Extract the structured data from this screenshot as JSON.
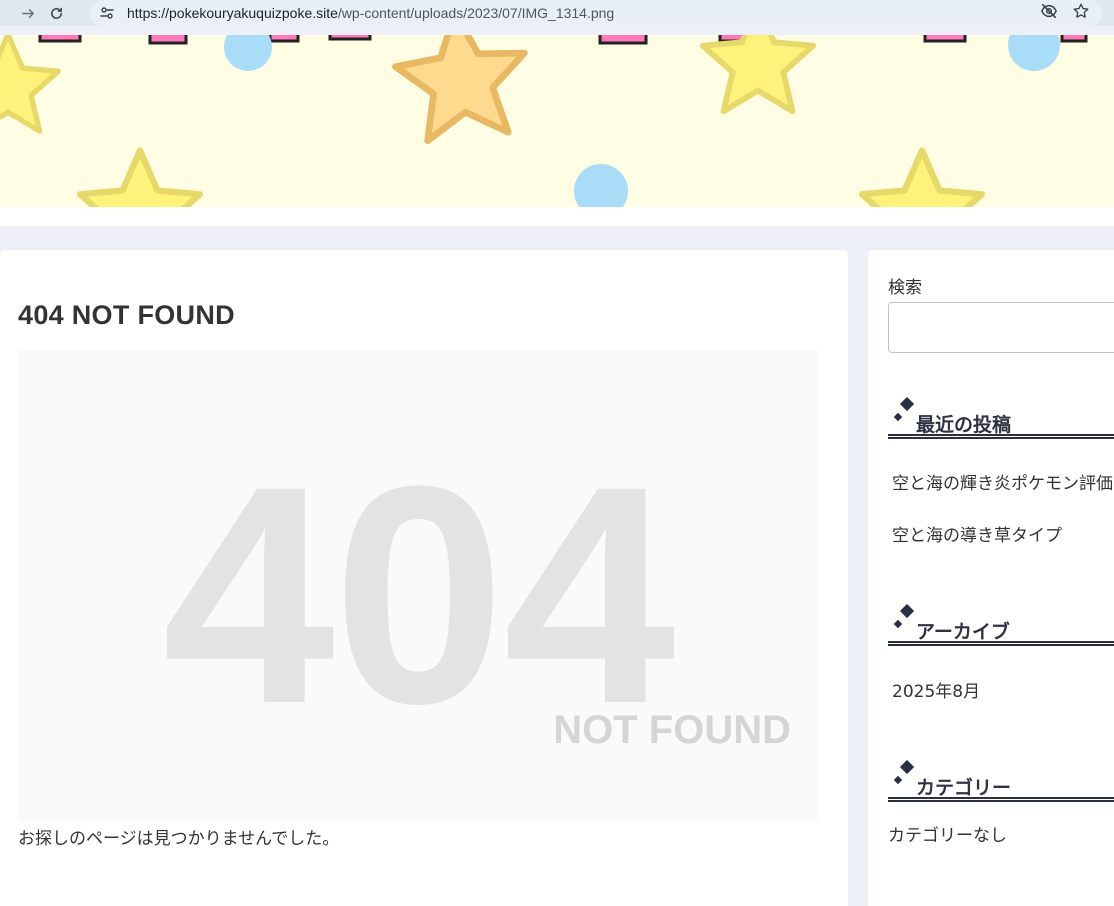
{
  "browser": {
    "url_host": "https://pokekouryakuquizpoke.site",
    "url_path": "/wp-content/uploads/2023/07/IMG_1314.png",
    "icons": [
      "forward-icon",
      "reload-icon",
      "site-info-icon",
      "eye-off-icon",
      "star-icon"
    ]
  },
  "header": {
    "banner_icons": [
      "star-icon",
      "circle-icon"
    ],
    "colors": {
      "background": "#fffde3",
      "star_yellow": "#fff27a",
      "star_orange": "#ffd98e",
      "circle_blue": "#a8dcf7"
    }
  },
  "main": {
    "title": "404 NOT FOUND",
    "image_big_text": "404",
    "image_sub_text": "NOT FOUND",
    "message": "お探しのページは見つかりませんでした。"
  },
  "sidebar": {
    "search_label": "検索",
    "search_value": "",
    "recent_posts": {
      "title": "最近の投稿",
      "items": [
        "空と海の輝き炎ポケモン評価",
        "空と海の導き草タイプ"
      ]
    },
    "archive": {
      "title": "アーカイブ",
      "items": [
        "2025年8月"
      ]
    },
    "category": {
      "title": "カテゴリー",
      "empty_text": "カテゴリーなし"
    }
  },
  "colors": {
    "accent": "#2a2f45",
    "page_background": "#eef0f8"
  }
}
